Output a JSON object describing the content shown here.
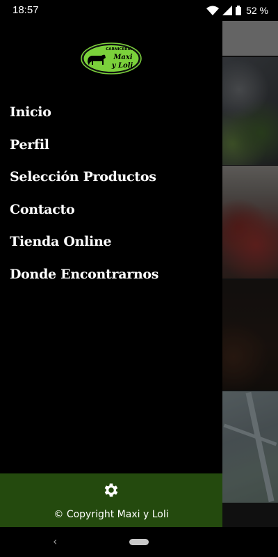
{
  "status_bar": {
    "time": "18:57",
    "battery": "52 %",
    "icons": [
      "wifi-icon",
      "signal-icon",
      "battery-icon"
    ]
  },
  "drawer": {
    "logo": {
      "top_text": "CARNICERÍA",
      "line1": "Maxi",
      "line2": "y Loli",
      "color": "#7bd13b"
    },
    "menu": [
      {
        "label": "Inicio"
      },
      {
        "label": "Perfil"
      },
      {
        "label": "Selección Productos"
      },
      {
        "label": "Contacto"
      },
      {
        "label": "Tienda Online"
      },
      {
        "label": "Donde Encontrarnos"
      }
    ],
    "footer": {
      "icon": "gear-icon",
      "copyright": "© Copyright Maxi y Loli",
      "color": "#244a0e"
    }
  },
  "nav_bar": {
    "back": "‹"
  }
}
